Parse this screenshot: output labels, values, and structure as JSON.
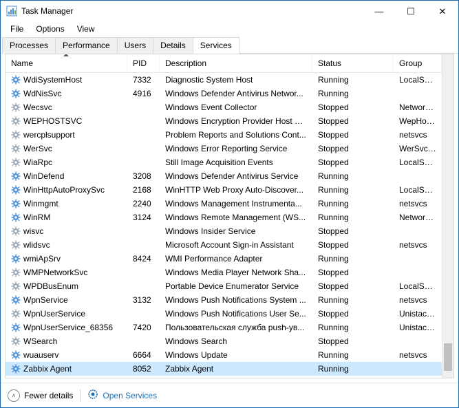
{
  "window": {
    "title": "Task Manager"
  },
  "menubar": {
    "file": "File",
    "options": "Options",
    "view": "View"
  },
  "tabs": {
    "processes": "Processes",
    "performance": "Performance",
    "users": "Users",
    "details": "Details",
    "services": "Services",
    "active": "services"
  },
  "columns": {
    "name": "Name",
    "pid": "PID",
    "description": "Description",
    "status": "Status",
    "group": "Group"
  },
  "status_labels": {
    "running": "Running",
    "stopped": "Stopped"
  },
  "services": [
    {
      "name": "WdiSystemHost",
      "pid": "7332",
      "description": "Diagnostic System Host",
      "status": "Running",
      "group": "LocalSystemN..."
    },
    {
      "name": "WdNisSvc",
      "pid": "4916",
      "description": "Windows Defender Antivirus Networ...",
      "status": "Running",
      "group": ""
    },
    {
      "name": "Wecsvc",
      "pid": "",
      "description": "Windows Event Collector",
      "status": "Stopped",
      "group": "NetworkService"
    },
    {
      "name": "WEPHOSTSVC",
      "pid": "",
      "description": "Windows Encryption Provider Host S...",
      "status": "Stopped",
      "group": "WepHostSvcG..."
    },
    {
      "name": "wercplsupport",
      "pid": "",
      "description": "Problem Reports and Solutions Cont...",
      "status": "Stopped",
      "group": "netsvcs"
    },
    {
      "name": "WerSvc",
      "pid": "",
      "description": "Windows Error Reporting Service",
      "status": "Stopped",
      "group": "WerSvcGroup"
    },
    {
      "name": "WiaRpc",
      "pid": "",
      "description": "Still Image Acquisition Events",
      "status": "Stopped",
      "group": "LocalSystemN..."
    },
    {
      "name": "WinDefend",
      "pid": "3208",
      "description": "Windows Defender Antivirus Service",
      "status": "Running",
      "group": ""
    },
    {
      "name": "WinHttpAutoProxySvc",
      "pid": "2168",
      "description": "WinHTTP Web Proxy Auto-Discover...",
      "status": "Running",
      "group": "LocalServiceN..."
    },
    {
      "name": "Winmgmt",
      "pid": "2240",
      "description": "Windows Management Instrumenta...",
      "status": "Running",
      "group": "netsvcs"
    },
    {
      "name": "WinRM",
      "pid": "3124",
      "description": "Windows Remote Management (WS...",
      "status": "Running",
      "group": "NetworkService"
    },
    {
      "name": "wisvc",
      "pid": "",
      "description": "Windows Insider Service",
      "status": "Stopped",
      "group": ""
    },
    {
      "name": "wlidsvc",
      "pid": "",
      "description": "Microsoft Account Sign-in Assistant",
      "status": "Stopped",
      "group": "netsvcs"
    },
    {
      "name": "wmiApSrv",
      "pid": "8424",
      "description": "WMI Performance Adapter",
      "status": "Running",
      "group": ""
    },
    {
      "name": "WMPNetworkSvc",
      "pid": "",
      "description": "Windows Media Player Network Sha...",
      "status": "Stopped",
      "group": ""
    },
    {
      "name": "WPDBusEnum",
      "pid": "",
      "description": "Portable Device Enumerator Service",
      "status": "Stopped",
      "group": "LocalSystemN..."
    },
    {
      "name": "WpnService",
      "pid": "3132",
      "description": "Windows Push Notifications System ...",
      "status": "Running",
      "group": "netsvcs"
    },
    {
      "name": "WpnUserService",
      "pid": "",
      "description": "Windows Push Notifications User Se...",
      "status": "Stopped",
      "group": "UnistackSvcGr..."
    },
    {
      "name": "WpnUserService_68356",
      "pid": "7420",
      "description": "Пользовательская служба push-ув...",
      "status": "Running",
      "group": "UnistackSvcGr..."
    },
    {
      "name": "WSearch",
      "pid": "",
      "description": "Windows Search",
      "status": "Stopped",
      "group": ""
    },
    {
      "name": "wuauserv",
      "pid": "6664",
      "description": "Windows Update",
      "status": "Running",
      "group": "netsvcs"
    },
    {
      "name": "Zabbix Agent",
      "pid": "8052",
      "description": "Zabbix Agent",
      "status": "Running",
      "group": "",
      "selected": true
    }
  ],
  "footer": {
    "fewer": "Fewer details",
    "open_services": "Open Services"
  },
  "icons": {
    "minimize": "—",
    "maximize": "☐",
    "close": "✕",
    "chevron_up": "˄"
  }
}
